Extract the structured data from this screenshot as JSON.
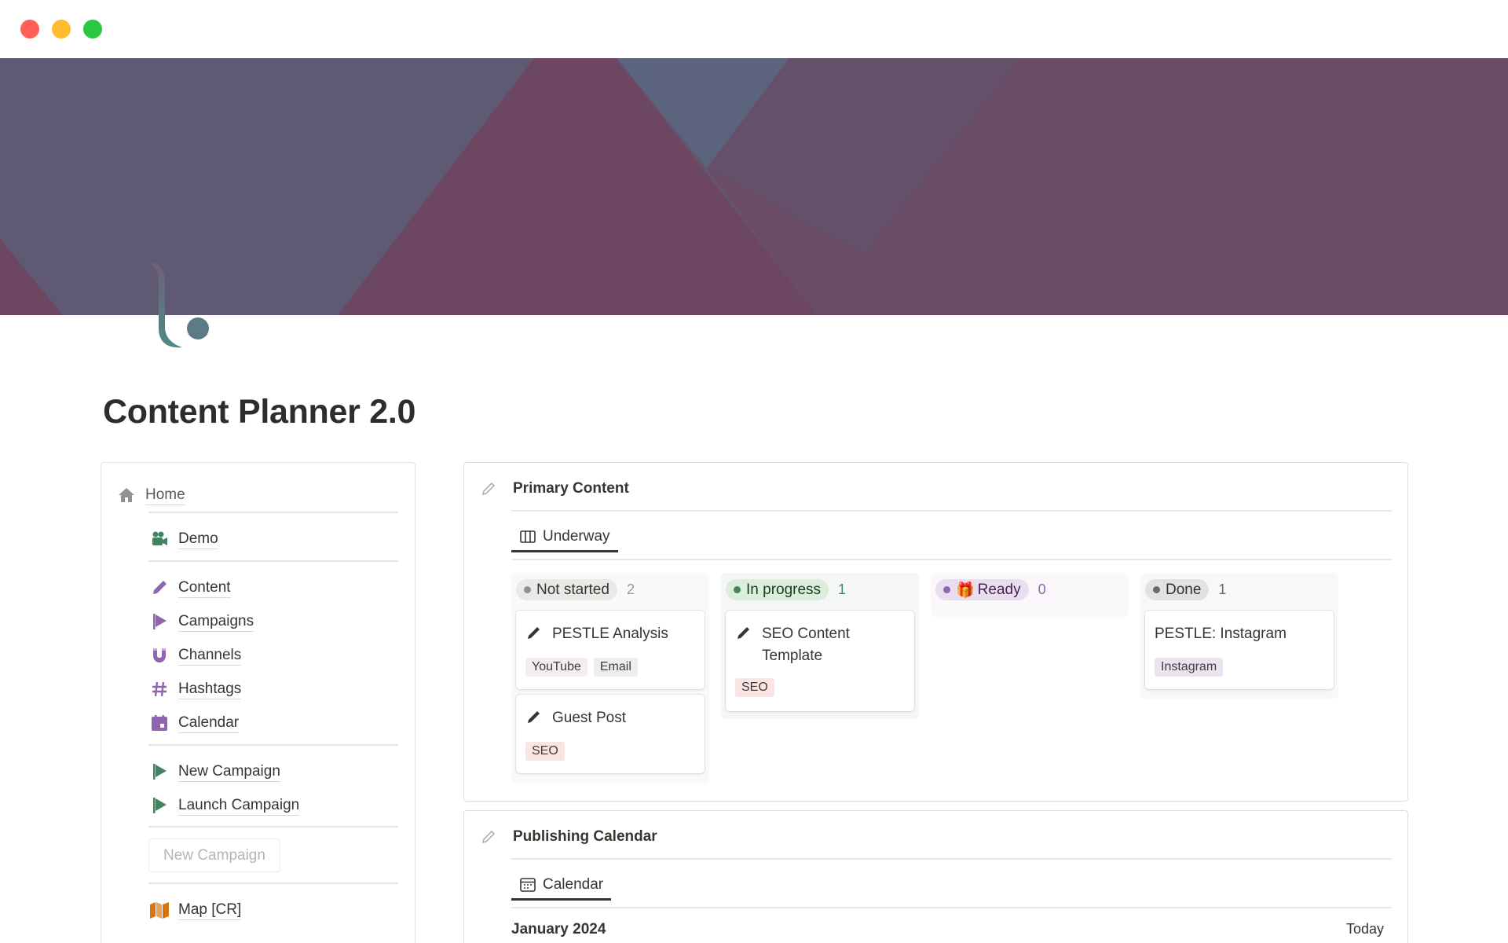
{
  "window": {
    "controls": [
      "close",
      "minimize",
      "zoom"
    ]
  },
  "page": {
    "title": "Content Planner 2.0",
    "icon": "logo-icon"
  },
  "colors": {
    "cover_start": "#595670",
    "cover_end": "#6a4b63",
    "accent_purple": "#9065b0",
    "accent_teal": "#448361"
  },
  "nav": {
    "home": {
      "label": "Home",
      "icon": "home-icon"
    },
    "items_1": [
      {
        "label": "Demo",
        "icon": "video-camera-icon"
      }
    ],
    "items_2": [
      {
        "label": "Content",
        "icon": "pencil-icon"
      },
      {
        "label": "Campaigns",
        "icon": "flag-icon"
      },
      {
        "label": "Channels",
        "icon": "magnet-icon"
      },
      {
        "label": "Hashtags",
        "icon": "hashtag-icon"
      },
      {
        "label": "Calendar",
        "icon": "calendar-icon"
      }
    ],
    "items_3": [
      {
        "label": "New Campaign",
        "icon": "flag-icon"
      },
      {
        "label": "Launch Campaign",
        "icon": "flag-icon"
      }
    ],
    "button": {
      "label": "New Campaign"
    },
    "items_4": [
      {
        "label": "Map [CR]",
        "icon": "map-icon"
      }
    ]
  },
  "primary": {
    "title": "Primary Content",
    "view_tab": "Underway",
    "columns": [
      {
        "status": "Not started",
        "count": "2",
        "cards": [
          {
            "title": "PESTLE Analysis",
            "tags": [
              "YouTube",
              "Email"
            ]
          },
          {
            "title": "Guest Post",
            "tags": [
              "SEO"
            ]
          }
        ]
      },
      {
        "status": "In progress",
        "count": "1",
        "cards": [
          {
            "title": "SEO Content Template",
            "tags": [
              "SEO"
            ]
          }
        ]
      },
      {
        "status": "Ready",
        "emoji": "🎁",
        "count": "0",
        "cards": []
      },
      {
        "status": "Done",
        "count": "1",
        "cards": [
          {
            "title": "PESTLE: Instagram",
            "tags": [
              "Instagram"
            ]
          }
        ]
      }
    ]
  },
  "calendar": {
    "title": "Publishing Calendar",
    "view_tab": "Calendar",
    "month": "January 2024",
    "today": "Today"
  }
}
